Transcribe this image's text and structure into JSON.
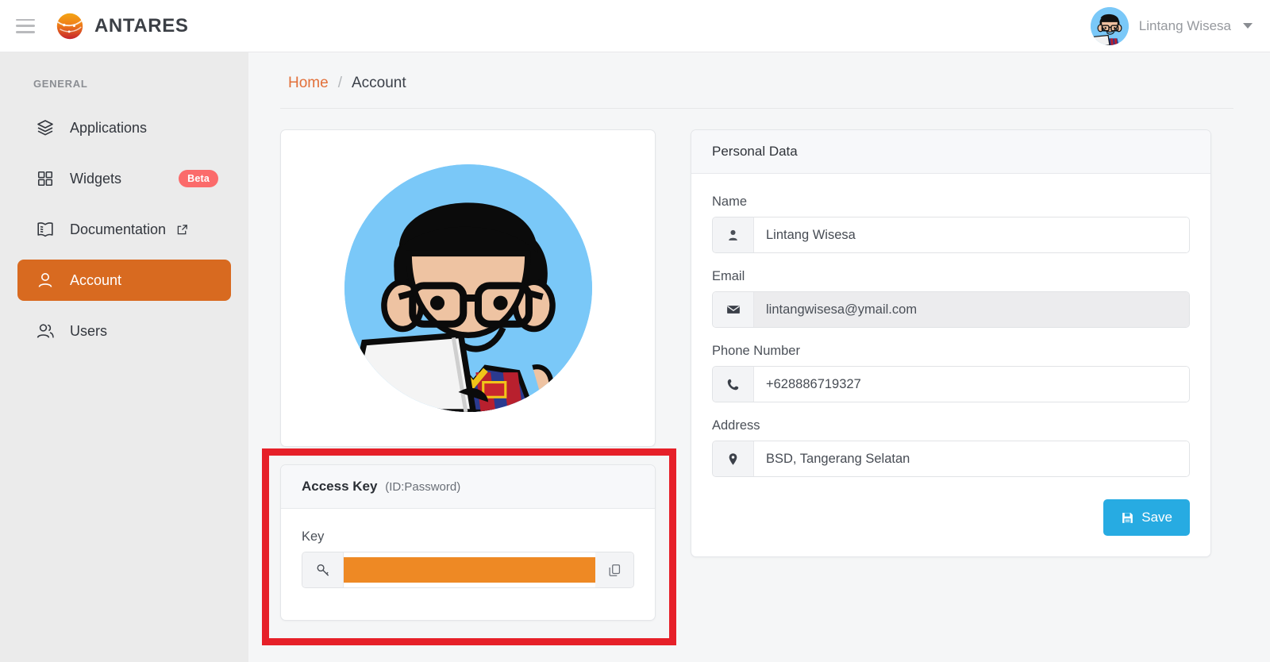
{
  "header": {
    "menu_icon": "hamburger-icon",
    "brand_name": "ANTARES",
    "brand_logo_icon": "antares-sphere-logo",
    "user_name": "Lintang Wisesa",
    "user_avatar_icon": "user-avatar",
    "dropdown_icon": "chevron-down-icon"
  },
  "sidebar": {
    "section_title": "GENERAL",
    "items": [
      {
        "label": "Applications",
        "icon": "layers-icon",
        "active": false,
        "badge": null,
        "external": false
      },
      {
        "label": "Widgets",
        "icon": "grid-icon",
        "active": false,
        "badge": "Beta",
        "external": false
      },
      {
        "label": "Documentation",
        "icon": "book-icon",
        "active": false,
        "badge": null,
        "external": true
      },
      {
        "label": "Account",
        "icon": "user-icon",
        "active": true,
        "badge": null,
        "external": false
      },
      {
        "label": "Users",
        "icon": "users-icon",
        "active": false,
        "badge": null,
        "external": false
      }
    ]
  },
  "breadcrumb": {
    "home": "Home",
    "separator": "/",
    "current": "Account"
  },
  "avatar_card": {
    "image_icon": "profile-illustration"
  },
  "access_key_card": {
    "title": "Access Key",
    "title_note": "(ID:Password)",
    "key_label": "Key",
    "key_icon": "key-icon",
    "key_value": "",
    "key_redacted": true,
    "copy_icon": "copy-icon",
    "highlight_color": "#e62029",
    "redaction_color": "#ee8924"
  },
  "personal_data_card": {
    "title": "Personal Data",
    "fields": [
      {
        "label": "Name",
        "value": "Lintang Wisesa",
        "icon": "user-icon",
        "disabled": false
      },
      {
        "label": "Email",
        "value": "lintangwisesa@ymail.com",
        "icon": "envelope-icon",
        "disabled": true
      },
      {
        "label": "Phone Number",
        "value": "+628886719327",
        "icon": "phone-icon",
        "disabled": false
      },
      {
        "label": "Address",
        "value": "BSD, Tangerang Selatan",
        "icon": "map-pin-icon",
        "disabled": false
      }
    ],
    "save_label": "Save",
    "save_icon": "floppy-save-icon",
    "save_color": "#27abe2"
  },
  "colors": {
    "accent_orange": "#d86a20",
    "brand_orange": "#e2703a",
    "beta_badge": "#fb6b6b",
    "save_blue": "#27abe2",
    "annotation_red": "#e62029"
  }
}
